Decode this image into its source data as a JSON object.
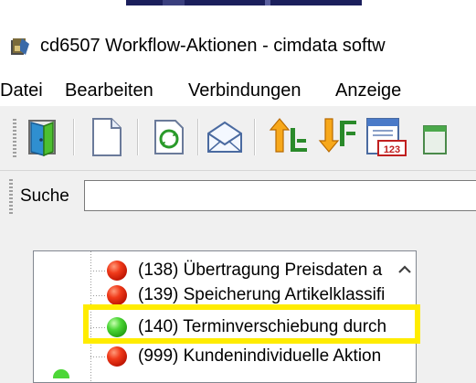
{
  "window": {
    "title": "cd6507 Workflow-Aktionen - cimdata softw"
  },
  "menubar": {
    "items": [
      "Datei",
      "Bearbeiten",
      "Verbindungen",
      "Anzeige"
    ]
  },
  "toolbar": {
    "icons": [
      "exit-door-icon",
      "new-document-icon",
      "refresh-document-icon",
      "envelope-icon",
      "sort-ascending-icon",
      "sort-descending-icon",
      "calendar-123-icon"
    ]
  },
  "search": {
    "label": "Suche",
    "value": ""
  },
  "tree": {
    "items": [
      {
        "label": "(138) Übertragung Preisdaten a",
        "status": "red"
      },
      {
        "label": "(139) Speicherung Artikelklassifi",
        "status": "red"
      },
      {
        "label": "(140) Terminverschiebung durch",
        "status": "green",
        "highlighted": true
      },
      {
        "label": "(999) Kundenindividuelle Aktion",
        "status": "red"
      }
    ]
  },
  "colors": {
    "highlight": "#ffec00",
    "status_red": "#e0301a",
    "status_green": "#3cc02a"
  }
}
